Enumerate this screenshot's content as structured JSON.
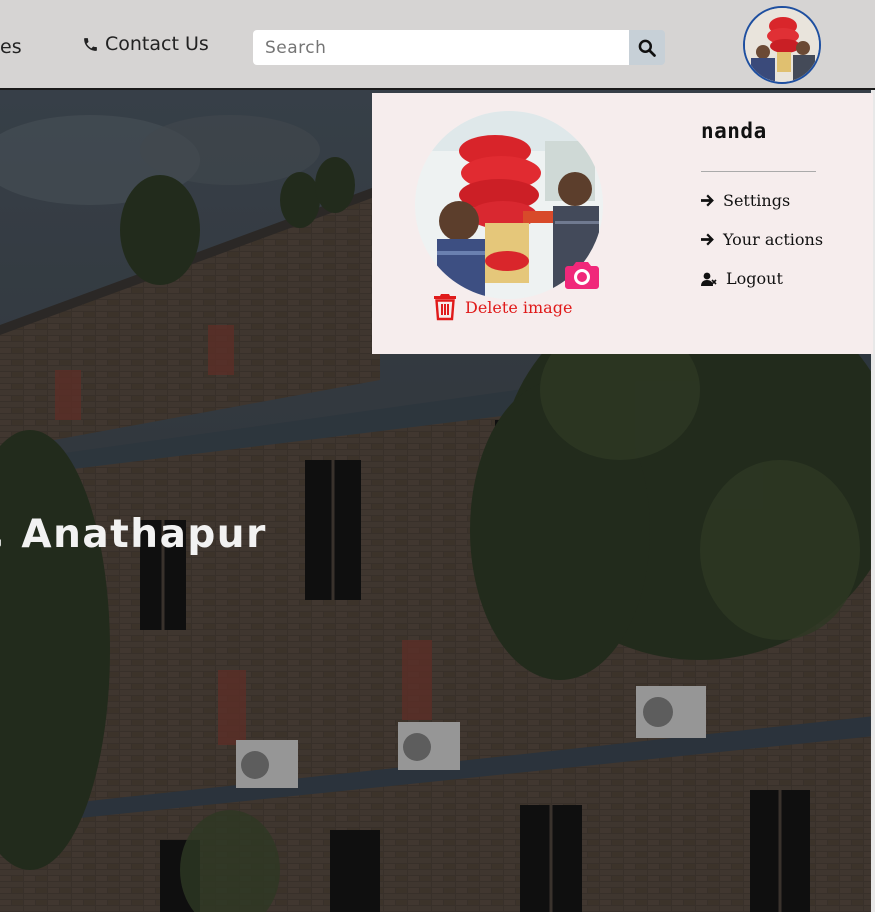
{
  "nav": {
    "partial_item": "es",
    "contact_label": "Contact Us",
    "search_placeholder": "Search"
  },
  "hero": {
    "heading": ", Anathapur"
  },
  "profile_menu": {
    "user_name": "nanda",
    "delete_image_label": "Delete image",
    "items": [
      {
        "label": "Settings",
        "icon": "arrow-right-icon"
      },
      {
        "label": "Your actions",
        "icon": "arrow-right-icon"
      },
      {
        "label": "Logout",
        "icon": "user-remove-icon"
      }
    ]
  },
  "colors": {
    "navbar_bg": "#d6d4d3",
    "dropdown_bg": "#f6eded",
    "delete_red": "#e01a1a",
    "camera_pink": "#f0287a",
    "avatar_border": "#1e4fa0"
  }
}
